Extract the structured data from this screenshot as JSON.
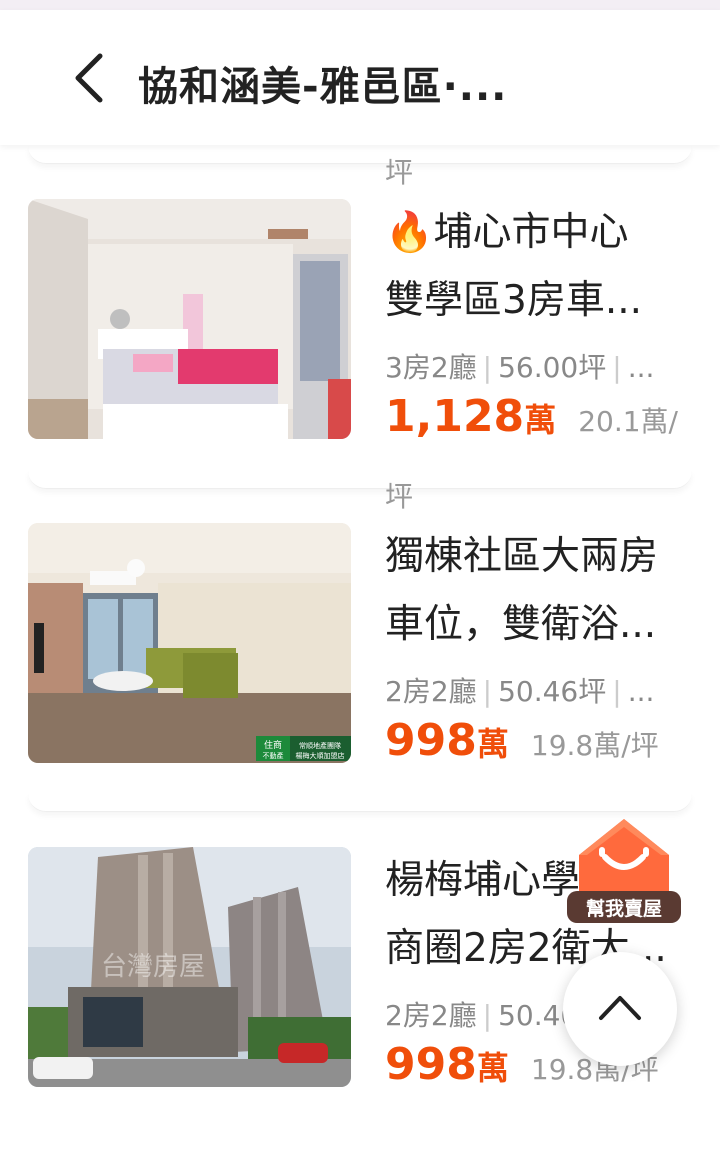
{
  "header": {
    "title": "協和涵美-雅邑區·..."
  },
  "partial_unit_top": "坪",
  "listings": [
    {
      "title_line1": "🔥埔心市中心",
      "title_line2": "雙學區3房車...",
      "rooms": "3房2廳",
      "area": "56.00坪",
      "more": "...",
      "price": "1,128",
      "price_unit": "萬",
      "price_per_ping": "20.1萬/",
      "price_per_ping_wrap": "坪"
    },
    {
      "title_line1": "獨棟社區大兩房",
      "title_line2": "車位，雙衛浴...",
      "rooms": "2房2廳",
      "area": "50.46坪",
      "more": "...",
      "price": "998",
      "price_unit": "萬",
      "price_per_ping": "19.8萬/坪",
      "watermark_left": "住商 不動產",
      "watermark_right": "常順地產團隊 楊梅大順加盟店"
    },
    {
      "title_line1": "楊梅埔心學區",
      "title_line2": "商圈2房2衛大...",
      "rooms": "2房2廳",
      "area": "50.46坪",
      "more": "...",
      "price": "998",
      "price_unit": "萬",
      "price_per_ping": "19.8萬/坪",
      "photo_watermark": "台灣房屋"
    }
  ],
  "fab": {
    "sell_label": "幫我賣屋"
  },
  "colors": {
    "price": "#f04e0a",
    "sell_badge": "#ff6a3d",
    "sell_label_bg": "#5a3a32"
  }
}
